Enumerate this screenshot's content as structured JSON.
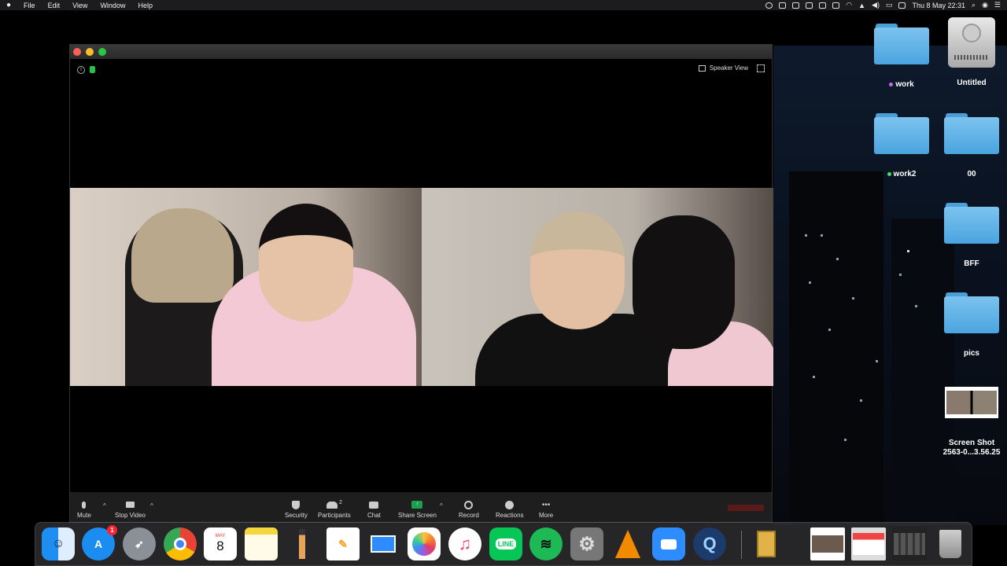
{
  "menubar": {
    "app_menu": [
      "File",
      "Edit",
      "View",
      "Window",
      "Help"
    ],
    "clock": "Thu  8 May  22:31"
  },
  "zoom": {
    "view_label": "Speaker View",
    "toolbar": {
      "mute": "Mute",
      "stop_video": "Stop Video",
      "security": "Security",
      "participants": "Participants",
      "participants_count": "2",
      "chat": "Chat",
      "share_screen": "Share Screen",
      "record": "Record",
      "reactions": "Reactions",
      "more": "More"
    }
  },
  "desktop_icons": [
    {
      "label": "work",
      "tag_color": "#c86ee0"
    },
    {
      "label": "Untitled"
    },
    {
      "label": "work2",
      "tag_color": "#4cd964"
    },
    {
      "label": "00"
    },
    {
      "label": "BFF"
    },
    {
      "label": "pics"
    },
    {
      "label": "Screen Shot\n2563-0...3.56.25"
    }
  ],
  "dock": {
    "badge_app_store": "1",
    "calendar_month": "MAY",
    "calendar_day": "8",
    "line_label": "LINE"
  },
  "colors": {
    "zoom_green": "#1aa14f",
    "zoom_blue": "#2d8cff",
    "folder_blue": "#5fb3e8"
  }
}
